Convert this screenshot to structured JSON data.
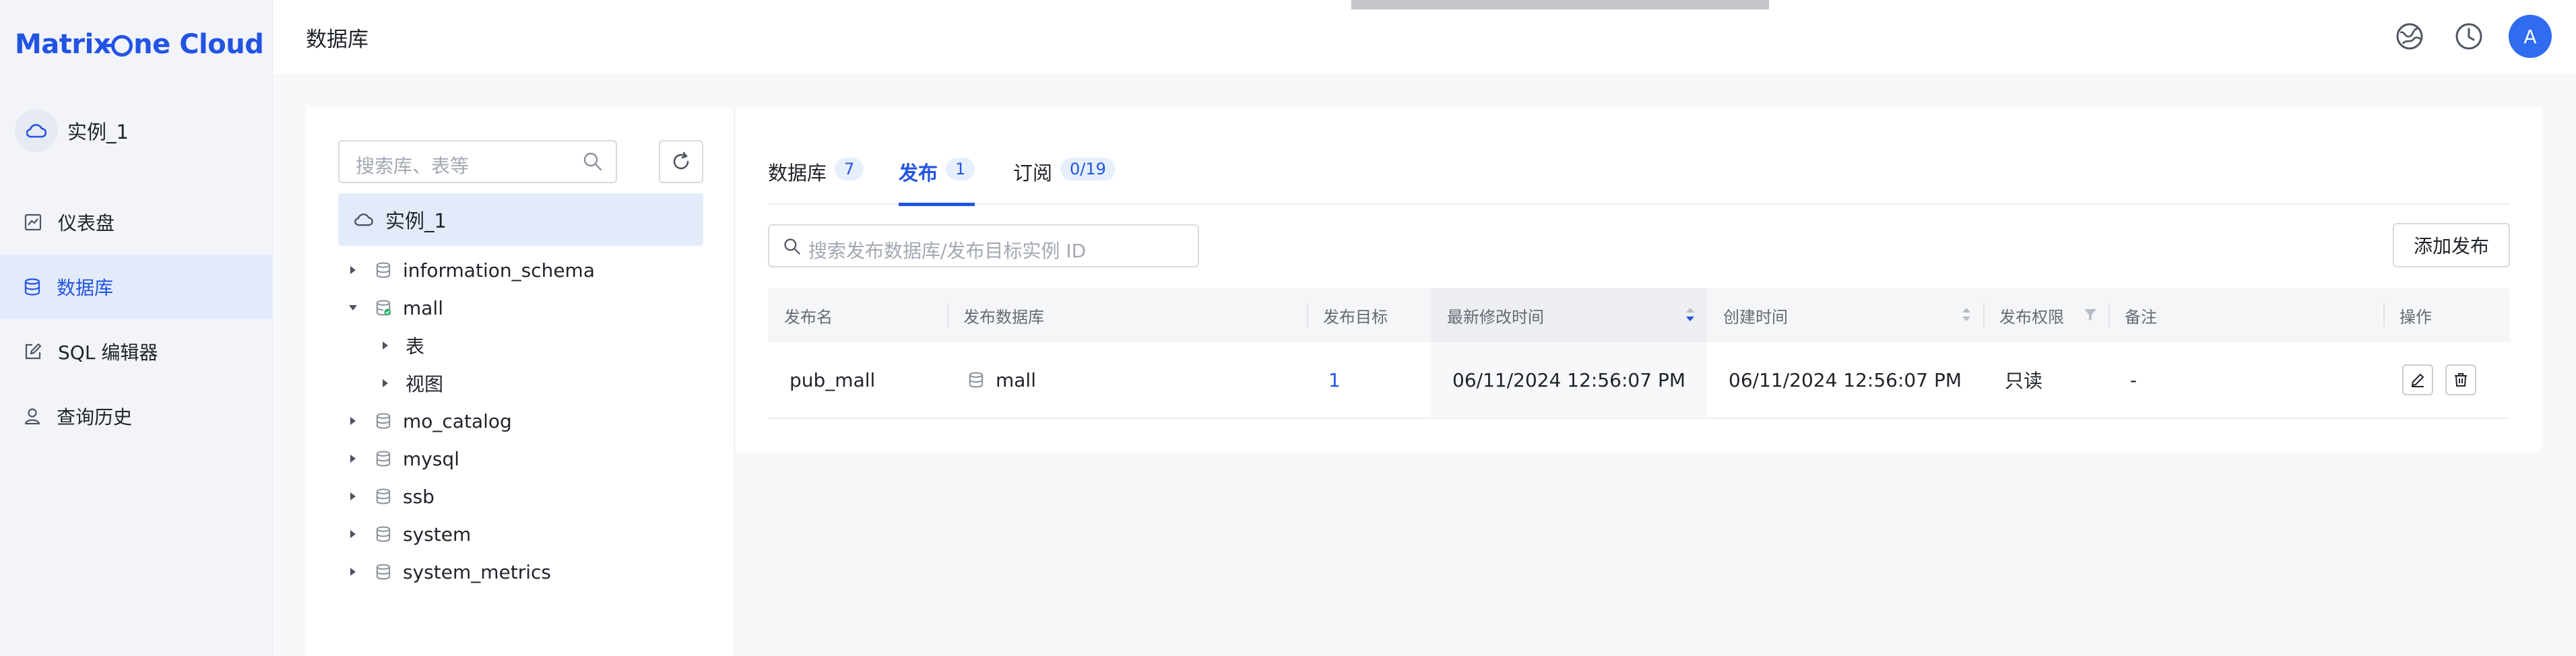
{
  "app": {
    "logo_pre": "Matrix",
    "logo_post": "ne Cloud",
    "brand_color": "#2254e4"
  },
  "sidebar": {
    "instance_name": "实例_1",
    "items": [
      {
        "label": "仪表盘",
        "icon": "chart-icon",
        "active": false
      },
      {
        "label": "数据库",
        "icon": "database-icon",
        "active": true
      },
      {
        "label": "SQL 编辑器",
        "icon": "edit-icon",
        "active": false
      },
      {
        "label": "查询历史",
        "icon": "history-user-icon",
        "active": false
      }
    ]
  },
  "header": {
    "title": "数据库",
    "avatar_letter": "A"
  },
  "tree": {
    "search_placeholder": "搜索库、表等",
    "root_label": "实例_1",
    "nodes": [
      {
        "label": "information_schema",
        "expanded": false
      },
      {
        "label": "mall",
        "expanded": true,
        "children": [
          {
            "label": "表"
          },
          {
            "label": "视图"
          }
        ]
      },
      {
        "label": "mo_catalog",
        "expanded": false
      },
      {
        "label": "mysql",
        "expanded": false
      },
      {
        "label": "ssb",
        "expanded": false
      },
      {
        "label": "system",
        "expanded": false
      },
      {
        "label": "system_metrics",
        "expanded": false
      }
    ]
  },
  "tabs": [
    {
      "label": "数据库",
      "badge": "7",
      "active": false
    },
    {
      "label": "发布",
      "badge": "1",
      "active": true
    },
    {
      "label": "订阅",
      "badge": "0/19",
      "active": false
    }
  ],
  "publish": {
    "search_placeholder": "搜索发布数据库/发布目标实例 ID",
    "add_label": "添加发布",
    "columns": [
      "发布名",
      "发布数据库",
      "发布目标",
      "最新修改时间",
      "创建时间",
      "发布权限",
      "备注",
      "操作"
    ],
    "rows": [
      {
        "name": "pub_mall",
        "database": "mall",
        "target": "1",
        "modified": "06/11/2024 12:56:07 PM",
        "created": "06/11/2024 12:56:07 PM",
        "permission": "只读",
        "note": "-"
      }
    ]
  }
}
